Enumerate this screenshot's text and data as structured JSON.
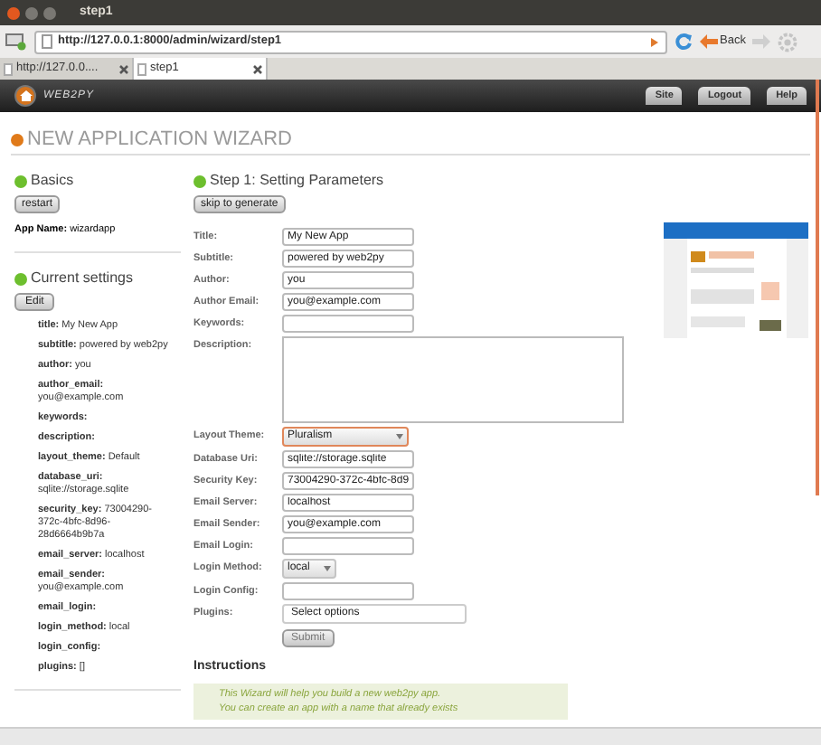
{
  "window": {
    "title": "step1"
  },
  "browser": {
    "url": "http://127.0.0.1:8000/admin/wizard/step1",
    "back_label": "Back",
    "tabs": [
      {
        "label": "http://127.0.0....",
        "selected": false
      },
      {
        "label": "step1",
        "selected": true
      }
    ]
  },
  "header": {
    "logo": "WEB2PY",
    "nav": [
      "Site",
      "Logout",
      "Help"
    ]
  },
  "page_title": "NEW APPLICATION WIZARD",
  "sidebar": {
    "basics": {
      "title": "Basics",
      "button": "restart",
      "app_name_label": "App Name:",
      "app_name": "wizardapp"
    },
    "current_settings": {
      "title": "Current settings",
      "button": "Edit",
      "items": [
        {
          "key": "title:",
          "value": "My New App"
        },
        {
          "key": "subtitle:",
          "value": "powered by web2py"
        },
        {
          "key": "author:",
          "value": "you"
        },
        {
          "key": "author_email:",
          "value": "you@example.com"
        },
        {
          "key": "keywords:",
          "value": ""
        },
        {
          "key": "description:",
          "value": ""
        },
        {
          "key": "layout_theme:",
          "value": "Default"
        },
        {
          "key": "database_uri:",
          "value": "sqlite://storage.sqlite"
        },
        {
          "key": "security_key:",
          "value": "73004290-372c-4bfc-8d96-28d6664b9b7a"
        },
        {
          "key": "email_server:",
          "value": "localhost"
        },
        {
          "key": "email_sender:",
          "value": "you@example.com"
        },
        {
          "key": "email_login:",
          "value": ""
        },
        {
          "key": "login_method:",
          "value": "local"
        },
        {
          "key": "login_config:",
          "value": ""
        },
        {
          "key": "plugins:",
          "value": "[]"
        }
      ]
    }
  },
  "main": {
    "title": "Step 1: Setting Parameters",
    "skip_button": "skip to generate",
    "fields": [
      {
        "label": "Title:",
        "kind": "text",
        "value": "My New App"
      },
      {
        "label": "Subtitle:",
        "kind": "text",
        "value": "powered by web2py"
      },
      {
        "label": "Author:",
        "kind": "text",
        "value": "you"
      },
      {
        "label": "Author Email:",
        "kind": "text",
        "value": "you@example.com"
      },
      {
        "label": "Keywords:",
        "kind": "text"
      },
      {
        "label": "Description:",
        "kind": "textarea"
      },
      {
        "label": "Layout Theme:",
        "kind": "select",
        "value": "Pluralism",
        "focused": true
      },
      {
        "label": "Database Uri:",
        "kind": "text",
        "value": "sqlite://storage.sqlite"
      },
      {
        "label": "Security Key:",
        "kind": "text",
        "value": "73004290-372c-4bfc-8d9"
      },
      {
        "label": "Email Server:",
        "kind": "text",
        "value": "localhost"
      },
      {
        "label": "Email Sender:",
        "kind": "text",
        "value": "you@example.com"
      },
      {
        "label": "Email Login:",
        "kind": "text"
      },
      {
        "label": "Login Method:",
        "kind": "small_select",
        "value": "local",
        "focused": false
      },
      {
        "label": "Login Config:",
        "kind": "text"
      },
      {
        "label": "Plugins:",
        "kind": "multiselect",
        "value": "Select options"
      }
    ],
    "submit": "Submit",
    "instructions": {
      "title": "Instructions",
      "lines": [
        "This Wizard will help you build a new web2py app.",
        "You can create an app with a name that already exists"
      ]
    }
  }
}
